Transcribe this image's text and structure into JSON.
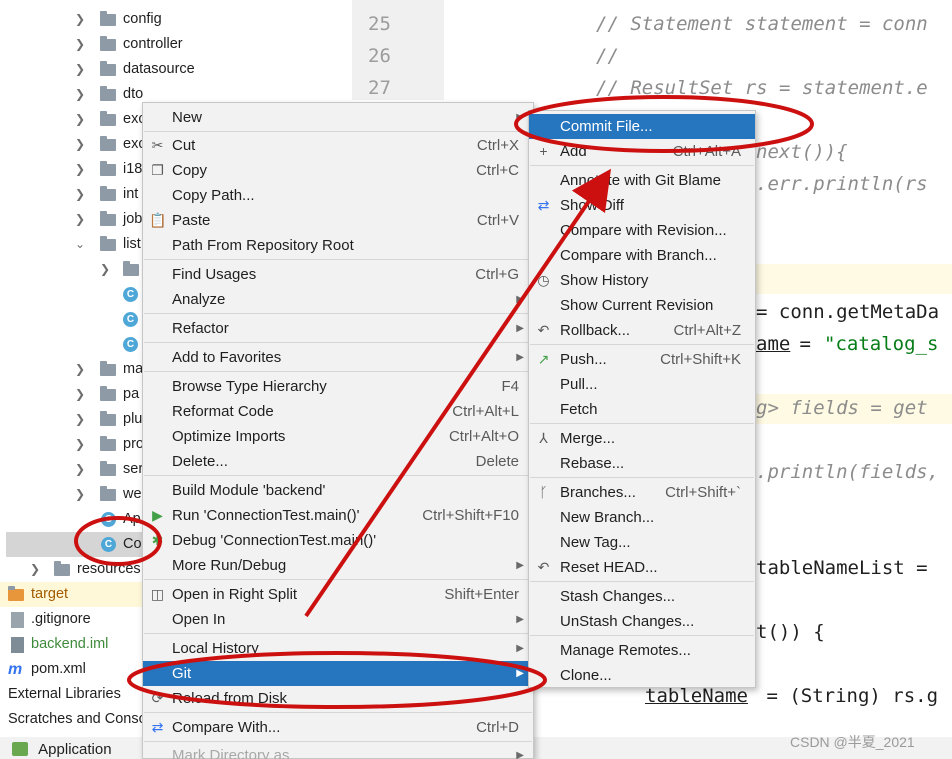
{
  "tree": {
    "items": [
      {
        "label": "config",
        "type": "folder"
      },
      {
        "label": "controller",
        "type": "folder"
      },
      {
        "label": "datasource",
        "type": "folder"
      },
      {
        "label": "dto",
        "type": "folder"
      },
      {
        "label": "exc",
        "type": "folder"
      },
      {
        "label": "exc",
        "type": "folder"
      },
      {
        "label": "i18",
        "type": "folder"
      },
      {
        "label": "int",
        "type": "folder"
      },
      {
        "label": "job",
        "type": "folder"
      },
      {
        "label": "list",
        "type": "folder",
        "expanded": true
      },
      {
        "label": "",
        "type": "folder"
      },
      {
        "label": "",
        "type": "class"
      },
      {
        "label": "",
        "type": "class"
      },
      {
        "label": "",
        "type": "class"
      },
      {
        "label": "ma",
        "type": "folder"
      },
      {
        "label": "pa",
        "type": "folder"
      },
      {
        "label": "plu",
        "type": "folder"
      },
      {
        "label": "pro",
        "type": "folder"
      },
      {
        "label": "ser",
        "type": "folder"
      },
      {
        "label": "we",
        "type": "folder"
      },
      {
        "label": "Ap",
        "type": "class"
      },
      {
        "label": "Co",
        "type": "class",
        "selected": true
      },
      {
        "label": "resources",
        "type": "folder"
      },
      {
        "label": "target",
        "type": "folder-orange"
      },
      {
        "label": ".gitignore",
        "type": "file"
      },
      {
        "label": "backend.iml",
        "type": "file-green"
      },
      {
        "label": "pom.xml",
        "type": "maven"
      },
      {
        "label": "External Libraries",
        "type": "lib"
      },
      {
        "label": "Scratches and Console",
        "type": "scratch"
      }
    ],
    "bottom_tab": "Application"
  },
  "editor": {
    "line_numbers": [
      "25",
      "26",
      "27"
    ],
    "lines": [
      "// Statement statement = conn",
      "//",
      "// ResultSet rs = statement.e",
      "next()){",
      ".err.println(rs",
      "= conn.getMetaDa",
      "ame",
      " = ",
      "\"catalog_s",
      "g> fields = get",
      ".println(fields,",
      "tableNameList =",
      "t()) {",
      "tableName",
      " = (String) rs.g"
    ]
  },
  "watermark": "CSDN @半夏_2021",
  "context_menu": {
    "items": [
      {
        "label": "New",
        "shortcut": "",
        "submenu": true,
        "icon": ""
      },
      {
        "label": "Cut",
        "shortcut": "Ctrl+X",
        "icon": "scissors-icon"
      },
      {
        "label": "Copy",
        "shortcut": "Ctrl+C",
        "icon": "copy-icon"
      },
      {
        "label": "Copy Path...",
        "shortcut": ""
      },
      {
        "label": "Paste",
        "shortcut": "Ctrl+V",
        "icon": "clipboard-icon"
      },
      {
        "label": "Path From Repository Root",
        "shortcut": ""
      },
      {
        "label": "Find Usages",
        "shortcut": "Ctrl+G"
      },
      {
        "label": "Analyze",
        "shortcut": "",
        "submenu": true
      },
      {
        "label": "Refactor",
        "shortcut": "",
        "submenu": true
      },
      {
        "label": "Add to Favorites",
        "shortcut": "",
        "submenu": true
      },
      {
        "label": "Browse Type Hierarchy",
        "shortcut": "F4"
      },
      {
        "label": "Reformat Code",
        "shortcut": "Ctrl+Alt+L"
      },
      {
        "label": "Optimize Imports",
        "shortcut": "Ctrl+Alt+O"
      },
      {
        "label": "Delete...",
        "shortcut": "Delete"
      },
      {
        "label": "Build Module 'backend'",
        "shortcut": ""
      },
      {
        "label": "Run 'ConnectionTest.main()'",
        "shortcut": "Ctrl+Shift+F10",
        "icon": "run-icon"
      },
      {
        "label": "Debug 'ConnectionTest.main()'",
        "shortcut": "",
        "icon": "debug-icon"
      },
      {
        "label": "More Run/Debug",
        "shortcut": "",
        "submenu": true
      },
      {
        "label": "Open in Right Split",
        "shortcut": "Shift+Enter",
        "icon": "split-icon"
      },
      {
        "label": "Open In",
        "shortcut": "",
        "submenu": true
      },
      {
        "label": "Local History",
        "shortcut": "",
        "submenu": true
      },
      {
        "label": "Git",
        "shortcut": "",
        "submenu": true,
        "highlighted": true
      },
      {
        "label": "Reload from Disk",
        "shortcut": "",
        "icon": "reload-icon"
      },
      {
        "label": "Compare With...",
        "shortcut": "Ctrl+D",
        "icon": "compare-icon"
      },
      {
        "label": "Mark Directory as",
        "shortcut": "",
        "submenu": true,
        "disabled": true
      }
    ]
  },
  "git_menu": {
    "items": [
      {
        "label": "Commit File...",
        "shortcut": "",
        "highlighted": true
      },
      {
        "label": "Add",
        "shortcut": "Ctrl+Alt+A",
        "icon": "plus-icon"
      },
      {
        "label": "Annotate with Git Blame",
        "shortcut": ""
      },
      {
        "label": "Show Diff",
        "shortcut": "",
        "icon": "diff-icon"
      },
      {
        "label": "Compare with Revision...",
        "shortcut": ""
      },
      {
        "label": "Compare with Branch...",
        "shortcut": ""
      },
      {
        "label": "Show History",
        "shortcut": "",
        "icon": "history-icon"
      },
      {
        "label": "Show Current Revision",
        "shortcut": ""
      },
      {
        "label": "Rollback...",
        "shortcut": "Ctrl+Alt+Z",
        "icon": "rollback-icon"
      },
      {
        "label": "Push...",
        "shortcut": "Ctrl+Shift+K",
        "icon": "push-icon"
      },
      {
        "label": "Pull...",
        "shortcut": ""
      },
      {
        "label": "Fetch",
        "shortcut": ""
      },
      {
        "label": "Merge...",
        "shortcut": "",
        "icon": "merge-icon"
      },
      {
        "label": "Rebase...",
        "shortcut": ""
      },
      {
        "label": "Branches...",
        "shortcut": "Ctrl+Shift+`",
        "icon": "branch-icon"
      },
      {
        "label": "New Branch...",
        "shortcut": ""
      },
      {
        "label": "New Tag...",
        "shortcut": ""
      },
      {
        "label": "Reset HEAD...",
        "shortcut": "",
        "icon": "reset-icon"
      },
      {
        "label": "Stash Changes...",
        "shortcut": ""
      },
      {
        "label": "UnStash Changes...",
        "shortcut": ""
      },
      {
        "label": "Manage Remotes...",
        "shortcut": ""
      },
      {
        "label": "Clone...",
        "shortcut": ""
      }
    ]
  },
  "colors": {
    "highlight": "#2675bf",
    "annotation": "#cc1010"
  }
}
